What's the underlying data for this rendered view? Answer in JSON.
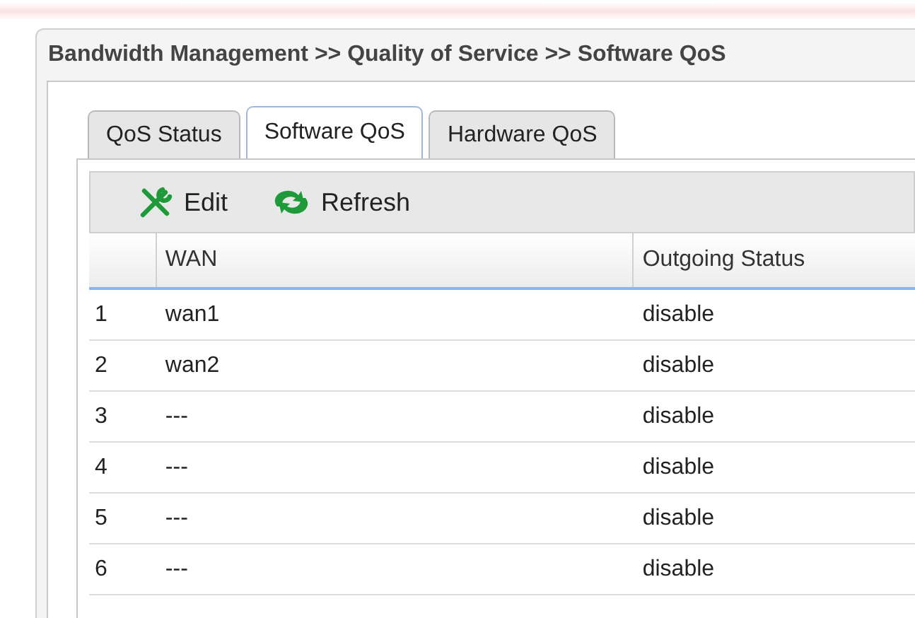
{
  "breadcrumb": "Bandwidth Management >> Quality of Service >> Software QoS",
  "tabs": [
    {
      "label": "QoS Status",
      "selected": false
    },
    {
      "label": "Software QoS",
      "selected": true
    },
    {
      "label": "Hardware QoS",
      "selected": false
    }
  ],
  "toolbar": [
    {
      "kind": "edit",
      "label": "Edit"
    },
    {
      "kind": "refresh",
      "label": "Refresh"
    }
  ],
  "table": {
    "columns": [
      "",
      "WAN",
      "Outgoing Status"
    ],
    "rows": [
      [
        "1",
        "wan1",
        "disable"
      ],
      [
        "2",
        "wan2",
        "disable"
      ],
      [
        "3",
        "---",
        "disable"
      ],
      [
        "4",
        "---",
        "disable"
      ],
      [
        "5",
        "---",
        "disable"
      ],
      [
        "6",
        "---",
        "disable"
      ]
    ]
  }
}
